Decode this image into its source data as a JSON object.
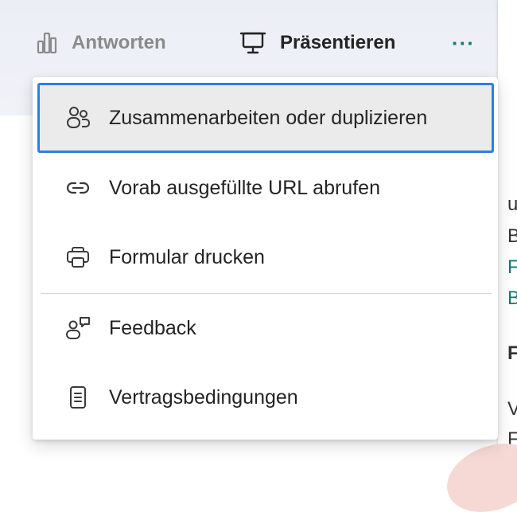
{
  "toolbar": {
    "answers_label": "Antworten",
    "answers_icon": "bar-chart-icon",
    "present_label": "Präsentieren",
    "present_icon": "presentation-monitor-icon",
    "more_label": "···",
    "more_icon": "more-options-icon"
  },
  "menu": {
    "items": [
      {
        "label": "Zusammenarbeiten oder duplizieren",
        "icon": "people-collaborate-icon",
        "focused": true
      },
      {
        "label": "Vorab ausgefüllte URL abrufen",
        "icon": "link-icon"
      },
      {
        "label": "Formular drucken",
        "icon": "printer-icon"
      },
      {
        "label": "Feedback",
        "icon": "person-feedback-icon"
      },
      {
        "label": "Vertragsbedingungen",
        "icon": "document-icon"
      }
    ]
  },
  "right_panel_fragments": [
    "u",
    "B",
    "F",
    "B",
    "F",
    "V",
    "F"
  ],
  "colors": {
    "accent_teal": "#107c6e",
    "focus_border": "#2f7ee3",
    "focused_bg": "#ebebeb",
    "text": "#242424"
  }
}
